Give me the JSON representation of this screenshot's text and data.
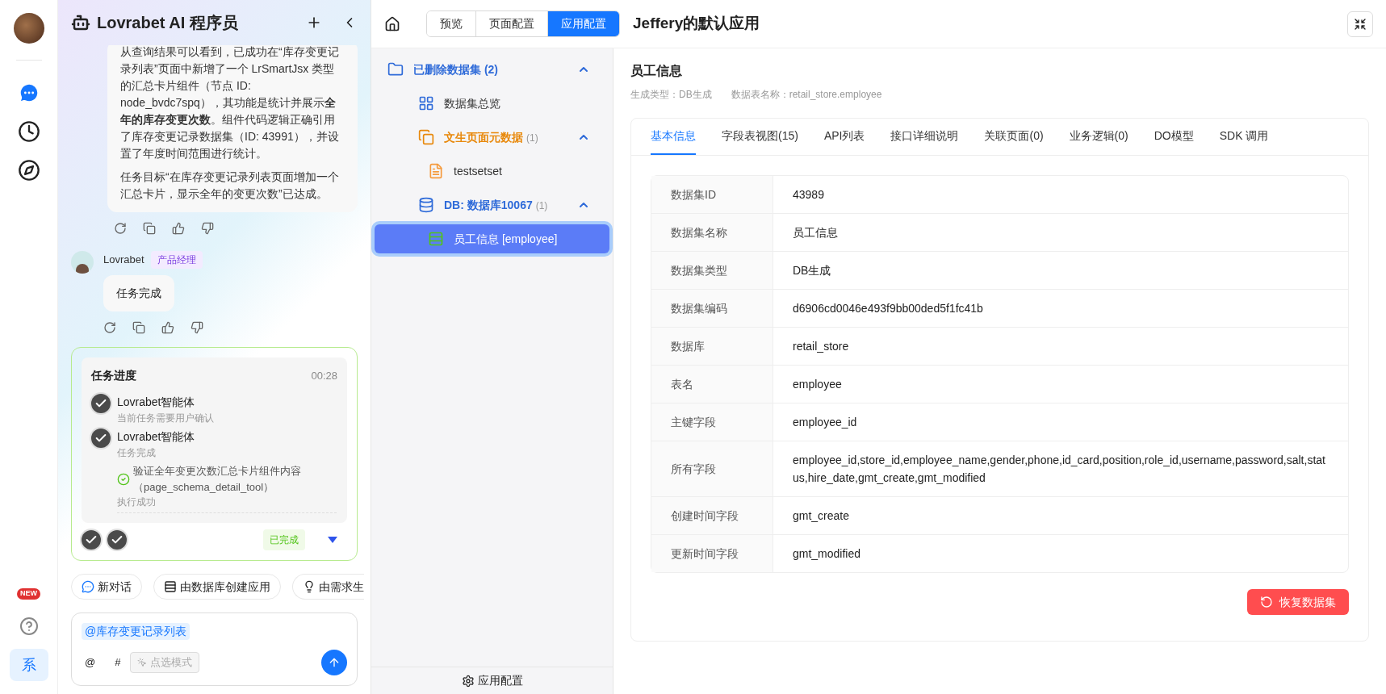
{
  "rail": {
    "items": [
      {
        "kind": "chat",
        "selected": true
      },
      {
        "kind": "history",
        "selected": false
      },
      {
        "kind": "explore",
        "selected": false
      }
    ],
    "badge": "NEW",
    "bottom": {
      "label": "系",
      "selected": true
    }
  },
  "chat": {
    "title": "Lovrabet AI 程序员",
    "reply": {
      "paragraphs": [
        "从查询结果可以看到，已成功在“库存变更记录列表”页面中新增了一个 LrSmartJsx 类型的汇总卡片组件（节点 ID: node_bvdc7spq），其功能是统计并展示**全年的库存变更次数**。组件代码逻辑正确引用了库存变更记录数据集（ID: 43991），并设置了年度时间范围进行统计。",
        "任务目标“在库存变更记录列表页面增加一个汇总卡片，显示全年的变更次数”已达成。"
      ]
    },
    "message": {
      "author": "Lovrabet",
      "role": "产品经理",
      "text": "任务完成"
    },
    "progress": {
      "title": "任务进度",
      "time": "00:28",
      "steps": [
        {
          "agent": "Lovrabet智能体",
          "status": "当前任务需要用户确认"
        },
        {
          "agent": "Lovrabet智能体",
          "status": "任务完成",
          "tool": {
            "name": "验证全年变更次数汇总卡片组件内容",
            "code": "（page_schema_detail_tool）",
            "result": "执行成功"
          }
        }
      ],
      "state": "已完成",
      "expanded": false
    },
    "quick_actions": [
      {
        "kind": "chat",
        "label": "新对话"
      },
      {
        "kind": "database",
        "label": "由数据库创建应用"
      },
      {
        "kind": "idea",
        "label": "由需求生"
      }
    ],
    "composer": {
      "mention": "@库存变更记录列表",
      "tools": [
        "@",
        "#"
      ],
      "mode": "点选模式"
    }
  },
  "header": {
    "tabs": [
      {
        "label": "预览",
        "selected": false
      },
      {
        "label": "页面配置",
        "selected": false
      },
      {
        "label": "应用配置",
        "selected": true
      }
    ],
    "app_title": "Jeffery的默认应用"
  },
  "tree": {
    "items": [
      {
        "kind": "folder",
        "label": "已删除数据集 (2)",
        "expanded": true,
        "selected": false,
        "children": [
          {
            "kind": "overview",
            "label": "数据集总览",
            "selected": false
          },
          {
            "kind": "meta",
            "label": "文生页面元数据",
            "count": "(1)",
            "expanded": true,
            "selected": false,
            "children": [
              {
                "kind": "page",
                "label": "testsetset",
                "selected": false
              }
            ]
          },
          {
            "kind": "database",
            "label": "DB: 数据库10067",
            "count": "(1)",
            "expanded": true,
            "selected": false,
            "children": [
              {
                "kind": "table",
                "label": "员工信息 [employee]",
                "selected": true
              }
            ]
          }
        ]
      }
    ],
    "footer": "应用配置"
  },
  "detail": {
    "title": "员工信息",
    "meta": [
      "生成类型：DB生成",
      "数据表名称：retail_store.employee"
    ],
    "tabs": [
      {
        "label": "基本信息",
        "selected": true
      },
      {
        "label": "字段表视图(15)",
        "selected": false
      },
      {
        "label": "API列表",
        "selected": false
      },
      {
        "label": "接口详细说明",
        "selected": false
      },
      {
        "label": "关联页面(0)",
        "selected": false
      },
      {
        "label": "业务逻辑(0)",
        "selected": false
      },
      {
        "label": "DO模型",
        "selected": false
      },
      {
        "label": "SDK 调用",
        "selected": false
      }
    ],
    "rows": [
      {
        "label": "数据集ID",
        "value": "43989"
      },
      {
        "label": "数据集名称",
        "value": "员工信息"
      },
      {
        "label": "数据集类型",
        "value": "DB生成"
      },
      {
        "label": "数据集编码",
        "value": "d6906cd0046e493f9bb00ded5f1fc41b"
      },
      {
        "label": "数据库",
        "value": "retail_store"
      },
      {
        "label": "表名",
        "value": "employee"
      },
      {
        "label": "主键字段",
        "value": "employee_id"
      },
      {
        "label": "所有字段",
        "value": "employee_id,store_id,employee_name,gender,phone,id_card,position,role_id,username,password,salt,status,hire_date,gmt_create,gmt_modified"
      },
      {
        "label": "创建时间字段",
        "value": "gmt_create"
      },
      {
        "label": "更新时间字段",
        "value": "gmt_modified"
      }
    ],
    "restore_button": "恢复数据集"
  }
}
